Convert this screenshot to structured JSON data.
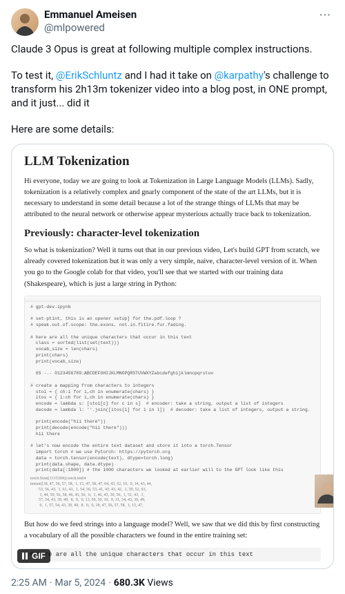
{
  "author": {
    "display_name": "Emmanuel Ameisen",
    "handle": "@mlpowered"
  },
  "more_glyph": "···",
  "tweet_text": {
    "p1": "Claude 3 Opus is great at following multiple complex instructions.",
    "p2_a": "To test it, ",
    "p2_m1": "@ErikSchluntz",
    "p2_b": " and I had it take on ",
    "p2_m2": "@karpathy",
    "p2_c": "'s challenge to transform his 2h13m tokenizer video into a blog post, in ONE prompt, and it just... did it",
    "p3": "Here are some details:"
  },
  "article": {
    "title": "LLM Tokenization",
    "intro": "Hi everyone, today we are going to look at Tokenization in Large Language Models (LLMs). Sadly, tokenization is a relatively complex and gnarly component of the state of the art LLMs, but it is necessary to understand in some detail because a lot of the strange things of LLMs that may be attributed to the neural network or otherwise appear mysterious actually trace back to tokenization.",
    "h2": "Previously: character-level tokenization",
    "p2": "So what is tokenization? Well it turns out that in our previous video, Let's build GPT from scratch, we already covered tokenization but it was only a very simple, naive, character-level version of it. When you go to the Google colab for that video, you'll see that we started with our training data (Shakespeare), which is just a large string in Python:",
    "colab_code": "# gpt-dev.ipynb\n\n# set-ptint, this is an opener setup] for the.pdf.loop ?\n# speak.out.of.scope: the.exons, not.in.fitire.fur.fading.\n\n# here are all the unique characters that occur in this text\n  class = sorted(list(set(text)))\n  vocab_size = len(chars)\n  print(chars)\n  print(vocab_size)\n\n  65 -.- 0123456789:ABCDEFGHIJKLMNOPQRSTUVWXYZabcdefghijklmnopqrstuv\n\n# create a mapping from characters to integers\n  stoi = { ch:i for i,ch in enumerate(chars) }\n  itos = { i:ch for i,ch in enumerate(chars) }\n  encode = lambda s: [stoi[c] for c in s]  # encoder: take a string, output a list of integers\n  decode = lambda l: ''.join([itos[i] for i in l])  # decoder: take a list of integers, output a string.\n\n  print(encode(\"hii there\"))\n  print(decode(encode(\"hii there\")))\n  hii there\n\n# let's now encode the entire text dataset and store it into a torch.Tensor\n  import torch # we use Pytorch: https://pytorch.org\n  data = torch.tensor(encode(text), dtype=torch.long)\n  print(data.shape, data.dtype)\n  print(data[:1000]) # the 1000 characters we looked at earlier will to the GPT look like this",
    "nums": "torch.Size([1115394]) torch.int64\ntensor([18, 47, 56, 57, 58,  1, 15, 47, 58, 47, 64, 43, 52, 10,  0, 14, 43, 44,\n        53, 56, 43,  1, 61, 43,  1, 54, 56, 53, 41, 43, 43, 42,  1, 39, 52, 63,\n         1, 44, 59, 56, 58, 46, 43, 56,  6,  1, 46, 43, 39, 56,  1, 51, 43,  1,\n        57, 54, 43, 39, 49,  8,  0,  0, 13, 50, 50, 10,  0, 31, 54, 43, 39, 49,\n         6,  1, 57, 54, 43, 39, 49,  8,  0,  0, 18, 47, 56, 57, 58,  1, 15, 47,",
    "p3": "But how do we feed strings into a language model? Well, we saw that we did this by first constructing a vocabulary of all the possible characters we found in the entire training set:",
    "code_snip": "# here are all the unique characters that occur in this text"
  },
  "gif_label": "GIF",
  "meta": {
    "time": "2:25 AM",
    "date": "Mar 5, 2024",
    "views_num": "680.3K",
    "views_word": " Views"
  }
}
